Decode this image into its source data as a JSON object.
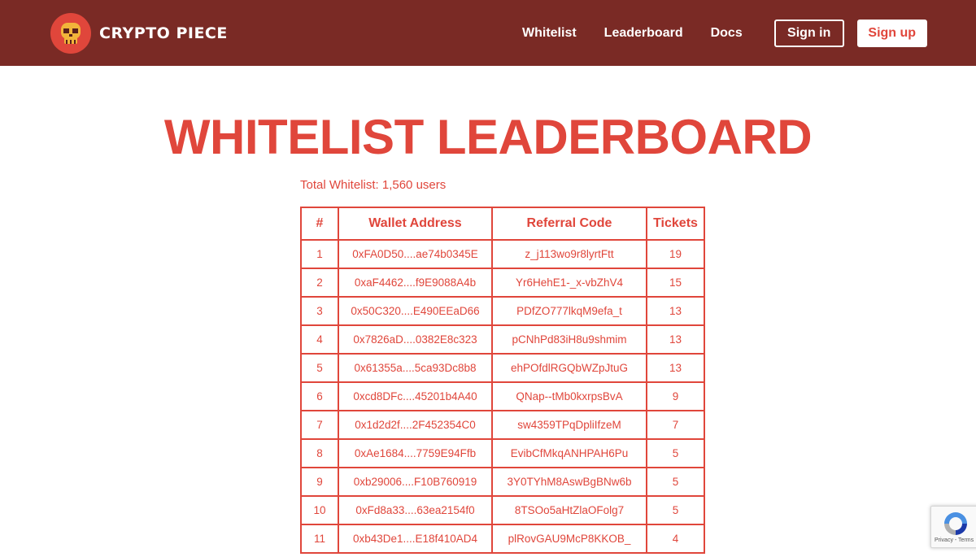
{
  "header": {
    "brand": "CRYPTO PIECE",
    "nav": [
      "Whitelist",
      "Leaderboard",
      "Docs"
    ],
    "sign_in": "Sign in",
    "sign_up": "Sign up",
    "bg_color": "#7a2a25",
    "accent_color": "#e0463b"
  },
  "main": {
    "title": "WHITELIST LEADERBOARD",
    "total": "Total Whitelist: 1,560 users",
    "table": {
      "headers": [
        "#",
        "Wallet Address",
        "Referral Code",
        "Tickets"
      ],
      "rows": [
        [
          "1",
          "0xFA0D50....ae74b0345E",
          "z_j113wo9r8lyrtFtt",
          "19"
        ],
        [
          "2",
          "0xaF4462....f9E9088A4b",
          "Yr6HehE1-_x-vbZhV4",
          "15"
        ],
        [
          "3",
          "0x50C320....E490EEaD66",
          "PDfZO777lkqM9efa_t",
          "13"
        ],
        [
          "4",
          "0x7826aD....0382E8c323",
          "pCNhPd83iH8u9shmim",
          "13"
        ],
        [
          "5",
          "0x61355a....5ca93Dc8b8",
          "ehPOfdlRGQbWZpJtuG",
          "13"
        ],
        [
          "6",
          "0xcd8DFc....45201b4A40",
          "QNap--tMb0kxrpsBvA",
          "9"
        ],
        [
          "7",
          "0x1d2d2f....2F452354C0",
          "sw4359TPqDpliIfzeM",
          "7"
        ],
        [
          "8",
          "0xAe1684....7759E94Ffb",
          "EvibCfMkqANHPAH6Pu",
          "5"
        ],
        [
          "9",
          "0xb29006....F10B760919",
          "3Y0TYhM8AswBgBNw6b",
          "5"
        ],
        [
          "10",
          "0xFd8a33....63ea2154f0",
          "8TSOo5aHtZlaOFolg7",
          "5"
        ],
        [
          "11",
          "0xb43De1....E18f410AD4",
          "plRovGAU9McP8KKOB_",
          "4"
        ]
      ]
    }
  },
  "recaptcha": {
    "label": "Privacy - Terms",
    "icon": "recaptcha-icon"
  }
}
